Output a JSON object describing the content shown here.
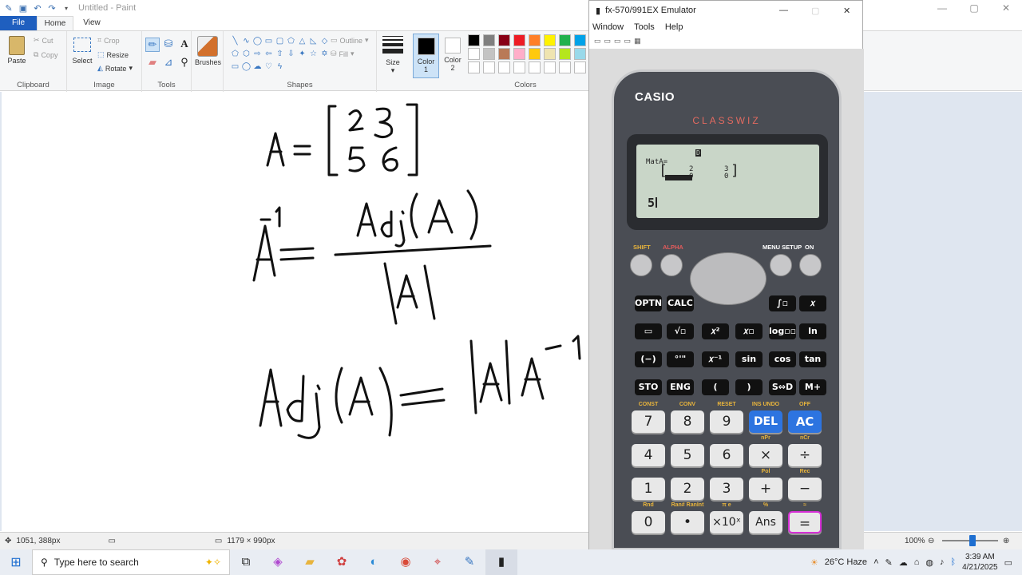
{
  "paint": {
    "title": "Untitled - Paint",
    "tabs": {
      "file": "File",
      "home": "Home",
      "view": "View"
    },
    "clipboard": {
      "paste": "Paste",
      "cut": "Cut",
      "copy": "Copy",
      "label": "Clipboard"
    },
    "image": {
      "select": "Select",
      "crop": "Crop",
      "resize": "Resize",
      "rotate": "Rotate",
      "label": "Image"
    },
    "tools": {
      "label": "Tools"
    },
    "brushes": {
      "label": "Brushes"
    },
    "shapes": {
      "outline": "Outline",
      "fill": "Fill",
      "label": "Shapes"
    },
    "size": {
      "label": "Size"
    },
    "color1": {
      "label": "Color\n1",
      "value": "#000000"
    },
    "color2": {
      "label": "Color\n2",
      "value": "#ffffff"
    },
    "colors": {
      "label": "Colors",
      "row1": [
        "#000000",
        "#7f7f7f",
        "#880015",
        "#ed1c24",
        "#ff7f27",
        "#fff200",
        "#22b14c",
        "#00a2e8"
      ],
      "row2": [
        "#ffffff",
        "#c3c3c3",
        "#b97a57",
        "#ffaec9",
        "#ffc90e",
        "#efe4b0",
        "#b5e61d",
        "#99d9ea"
      ]
    },
    "status": {
      "cursor": "1051, 388px",
      "canvas_size": "1179 × 990px",
      "zoom": "100%"
    }
  },
  "emulator": {
    "title": "fx-570/991EX Emulator",
    "menu": [
      "Window",
      "Tools",
      "Help"
    ],
    "brand": "CASIO",
    "model": "CLASSWIZ",
    "lcd": {
      "indicator": "D",
      "line1": "MatA=",
      "matrix_row1": [
        "2",
        "3"
      ],
      "matrix_row2": [
        "0",
        "0"
      ],
      "input": "5"
    },
    "top_labels": {
      "shift": "SHIFT",
      "alpha": "ALPHA",
      "menu": "MENU SETUP",
      "on": "ON"
    },
    "func_keys": [
      [
        "OPTN",
        "CALC",
        "∫▫",
        "𝑥"
      ],
      [
        "▭",
        "√▫",
        "𝑥²",
        "𝑥▫",
        "log▫▫",
        "ln"
      ],
      [
        "(−)",
        "°'\"",
        "𝑥⁻¹",
        "sin",
        "cos",
        "tan"
      ],
      [
        "STO",
        "ENG",
        "(",
        ")",
        "S⇔D",
        "M+"
      ]
    ],
    "num_keys": [
      [
        "7",
        "8",
        "9",
        "DEL",
        "AC"
      ],
      [
        "4",
        "5",
        "6",
        "×",
        "÷"
      ],
      [
        "1",
        "2",
        "3",
        "+",
        "−"
      ],
      [
        "0",
        "•",
        "×10ˣ",
        "Ans",
        "="
      ]
    ],
    "sub_labels": {
      "row7": [
        "CONST",
        "CONV",
        "RESET",
        "INS  UNDO",
        "OFF"
      ],
      "row4": [
        "",
        "",
        "",
        "nPr",
        "nCr"
      ],
      "row1": [
        "",
        "",
        "",
        "Pol",
        "Rec"
      ],
      "row0": [
        "Rnd",
        "Ran#  RanInt",
        "π     e",
        "%",
        "≈"
      ]
    }
  },
  "taskbar": {
    "search_placeholder": "Type here to search",
    "weather": "26°C  Haze",
    "time": "3:39 AM",
    "date": "4/21/2025"
  }
}
